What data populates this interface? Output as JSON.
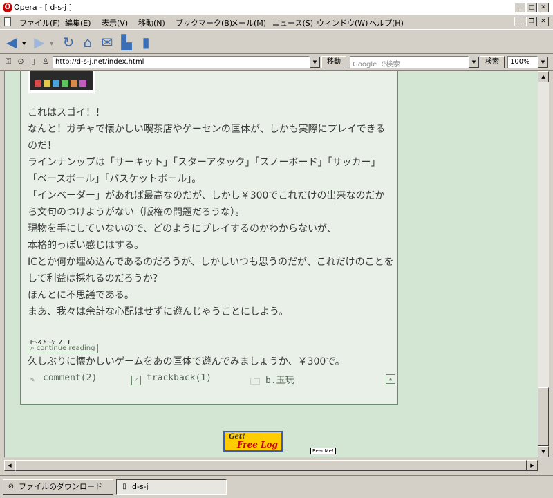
{
  "window": {
    "title": "Opera - [ d-s-j ]",
    "logo": "O"
  },
  "menu": {
    "items": [
      "ファイル(F)",
      "編集(E)",
      "表示(V)",
      "移動(N)",
      "ブックマーク(B)",
      "メール(M)",
      "ニュース(S)",
      "ウィンドウ(W)",
      "ヘルプ(H)"
    ]
  },
  "toolbar": {
    "icons": [
      "back-icon",
      "forward-icon",
      "reload-icon",
      "home-icon",
      "hotlist-icon",
      "print-icon",
      "document-icon"
    ]
  },
  "address": {
    "url": "http://d-s-j.net/index.html",
    "go_label": "移動",
    "search_placeholder": "Google で検索",
    "search_label": "検索",
    "zoom": "100%"
  },
  "post": {
    "body": [
      "これはスゴイ！！",
      "なんと！ガチャで懐かしい喫茶店やゲーセンの匡体が、しかも実際にプレイできるのだ！",
      "ラインナンップは「サーキット」「スターアタック」「スノーボード」「サッカー」「ベースボール」「バスケットボール」。",
      "「インベーダー」があれば最高なのだが、しかし￥300でこれだけの出来なのだから文句のつけようがない（版権の問題だろうな）。",
      "現物を手にしていないので、どのようにプレイするのかわからないが、",
      "本格的っぽい感じはする。",
      "ICとか何か埋め込んであるのだろうが、しかしいつも思うのだが、これだけのことをして利益は採れるのだろうか？",
      "ほんとに不思議である。",
      "まあ、我々は余計な心配はせずに遊んじゃうことにしよう。",
      "",
      "お父さん！",
      "久しぶりに懐かしいゲームをあの匡体で遊んでみましょうか、￥300で。"
    ],
    "continue_label": "continue reading",
    "comment": "comment(2)",
    "trackback": "trackback(1)",
    "category": "b.玉玩"
  },
  "banner": {
    "get": "Get!",
    "freelog": "Free Log",
    "readme": "ReadMe!"
  },
  "tabs": [
    {
      "label": "ファイルのダウンロード",
      "active": false
    },
    {
      "label": "d-s-j",
      "active": true
    }
  ],
  "colors": {
    "page_bg": "#d2e6d3",
    "post_bg": "#e8f0e8",
    "accent": "#3b6fb5"
  }
}
